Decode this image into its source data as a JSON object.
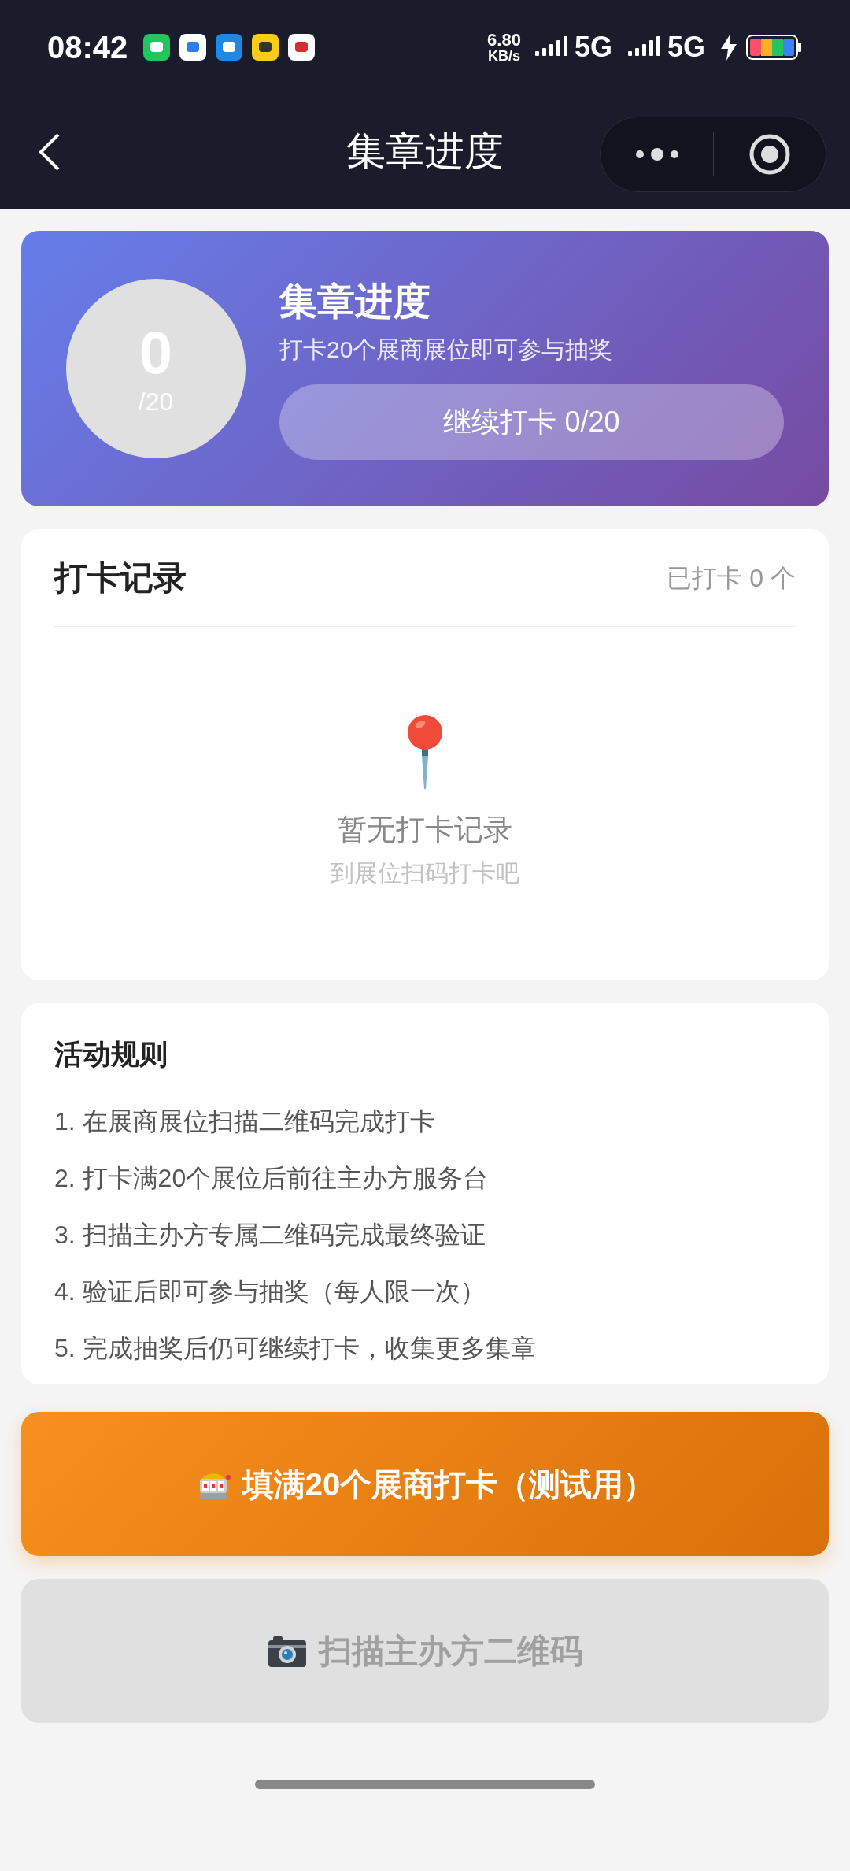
{
  "status_bar": {
    "time": "08:42",
    "speed_value": "6.80",
    "speed_unit": "KB/s",
    "signals": [
      {
        "label": "5G"
      },
      {
        "label": "5G"
      }
    ],
    "charging": true
  },
  "nav": {
    "title": "集章进度"
  },
  "progress": {
    "count": "0",
    "total": "/20",
    "title": "集章进度",
    "subtitle": "打卡20个展商展位即可参与抽奖",
    "button": "继续打卡 0/20"
  },
  "records": {
    "title": "打卡记录",
    "count": "已打卡 0 个",
    "empty_title": "暂无打卡记录",
    "empty_hint": "到展位扫码打卡吧"
  },
  "rules": {
    "title": "活动规则",
    "items": [
      "1. 在展商展位扫描二维码完成打卡",
      "2. 打卡满20个展位后前往主办方服务台",
      "3. 扫描主办方专属二维码完成最终验证",
      "4. 验证后即可参与抽奖（每人限一次）",
      "5. 完成抽奖后仍可继续打卡，收集更多集章"
    ]
  },
  "actions": [
    {
      "kind": "slot",
      "label": "填满20个展商打卡（测试用）",
      "disabled": false
    },
    {
      "kind": "camera",
      "label": "扫描主办方二维码",
      "disabled": true
    }
  ]
}
